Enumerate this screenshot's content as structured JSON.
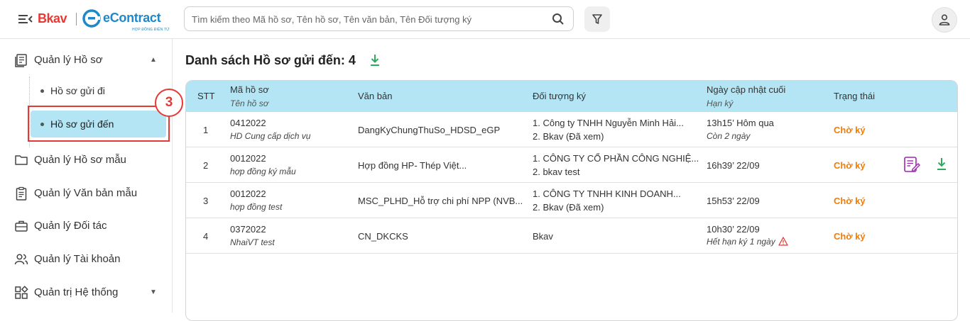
{
  "header": {
    "brand_bkav": "Bkav",
    "brand_econtract": "eContract",
    "brand_sub": "HỢP ĐỒNG ĐIỆN TỬ",
    "search_placeholder": "Tìm kiếm theo Mã hồ sơ, Tên hồ sơ, Tên văn bản, Tên Đối tượng ký"
  },
  "sidebar": {
    "items": [
      {
        "label": "Quản lý Hồ sơ",
        "icon": "document-list-icon"
      },
      {
        "label": "Quản lý Hồ sơ mẫu",
        "icon": "folder-icon"
      },
      {
        "label": "Quản lý Văn bản mẫu",
        "icon": "clipboard-icon"
      },
      {
        "label": "Quản lý Đối tác",
        "icon": "briefcase-icon"
      },
      {
        "label": "Quản lý Tài khoản",
        "icon": "users-icon"
      },
      {
        "label": "Quản trị Hệ thống",
        "icon": "apps-icon"
      }
    ],
    "sub_items": [
      {
        "label": "Hồ sơ gửi đi"
      },
      {
        "label": "Hồ sơ gửi đến"
      }
    ],
    "annotation_number": "3"
  },
  "main": {
    "title": "Danh sách Hồ sơ gửi đến: 4",
    "columns": {
      "stt": "STT",
      "ma_ho_so": "Mã hồ sơ",
      "ten_ho_so": "Tên hồ sơ",
      "van_ban": "Văn bản",
      "doi_tuong_ky": "Đối tượng ký",
      "ngay_cap_nhat": "Ngày cập nhật cuối",
      "han_ky": "Hạn ký",
      "trang_thai": "Trạng thái"
    },
    "rows": [
      {
        "stt": "1",
        "ma": "0412022",
        "ten": "HD Cung cấp dịch vụ",
        "van_ban": "DangKyChungThuSo_HDSD_eGP",
        "dt1": "1. Công ty TNHH Nguyễn Minh Hải...",
        "dt2": "2. Bkav (Đã xem)",
        "ngay": "13h15’ Hôm qua",
        "han": "Còn 2 ngày",
        "trang_thai": "Chờ ký"
      },
      {
        "stt": "2",
        "ma": "0012022",
        "ten": "hợp đồng ký mẫu",
        "van_ban": "Hợp đồng HP- Thép Việt...",
        "dt1": "1. CÔNG TY CỔ PHẦN CÔNG NGHIỆ...",
        "dt2": "2. bkav test",
        "ngay": "16h39’ 22/09",
        "han": "",
        "trang_thai": "Chờ ký"
      },
      {
        "stt": "3",
        "ma": "0012022",
        "ten": "hợp đồng test",
        "van_ban": "MSC_PLHD_Hỗ trợ chi phí NPP (NVB...",
        "dt1": "1. CÔNG TY TNHH KINH DOANH...",
        "dt2": "2. Bkav (Đã xem)",
        "ngay": "15h53’ 22/09",
        "han": "",
        "trang_thai": "Chờ ký"
      },
      {
        "stt": "4",
        "ma": "0372022",
        "ten": "NhaiVT test",
        "van_ban": "CN_DKCKS",
        "dt1": "Bkav",
        "dt2": "",
        "ngay": "10h30’ 22/09",
        "han": "Hết hạn ký 1 ngày",
        "trang_thai": "Chờ ký"
      }
    ]
  },
  "colors": {
    "accent": "#b3e5f5",
    "brand_red": "#e53935",
    "brand_blue": "#1e88c8",
    "status_orange": "#f57c00",
    "download_green": "#2eaa5c",
    "sign_purple": "#9c27b0"
  }
}
